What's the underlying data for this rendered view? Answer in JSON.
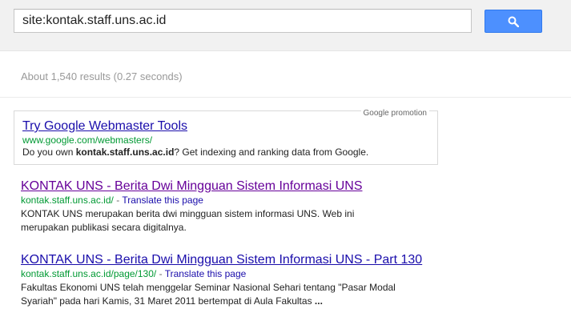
{
  "search": {
    "query": "site:kontak.staff.uns.ac.id",
    "button_icon": "search-icon"
  },
  "stats": {
    "text": "About 1,540 results (0.27 seconds)"
  },
  "promotion": {
    "tag": "Google promotion",
    "title": "Try Google Webmaster Tools",
    "url": "www.google.com/webmasters/",
    "desc_prefix": "Do you own ",
    "desc_bold": "kontak.staff.uns.ac.id",
    "desc_suffix": "? Get indexing and ranking data from Google."
  },
  "results": [
    {
      "title": "KONTAK UNS - Berita Dwi Mingguan Sistem Informasi UNS",
      "url": "kontak.staff.uns.ac.id/",
      "separator": " - ",
      "translate": "Translate this page",
      "snippet_line1": "KONTAK UNS merupakan berita dwi mingguan sistem informasi UNS. Web ini",
      "snippet_line2": "merupakan publikasi secara digitalnya."
    },
    {
      "title": "KONTAK UNS - Berita Dwi Mingguan Sistem Informasi UNS - Part 130",
      "url": "kontak.staff.uns.ac.id/page/130/",
      "separator": " - ",
      "translate": "Translate this page",
      "snippet_line1": "Fakultas Ekonomi UNS telah menggelar Seminar Nasional Sehari tentang \"Pasar Modal",
      "snippet_line2": "Syariah\" pada hari Kamis, 31 Maret 2011 bertempat di Aula Fakultas ",
      "snippet_ellipsis": "..."
    }
  ],
  "colors": {
    "link": "#1a0dab",
    "visited_link": "#660099",
    "url_green": "#009933",
    "search_button": "#4d90fe"
  }
}
